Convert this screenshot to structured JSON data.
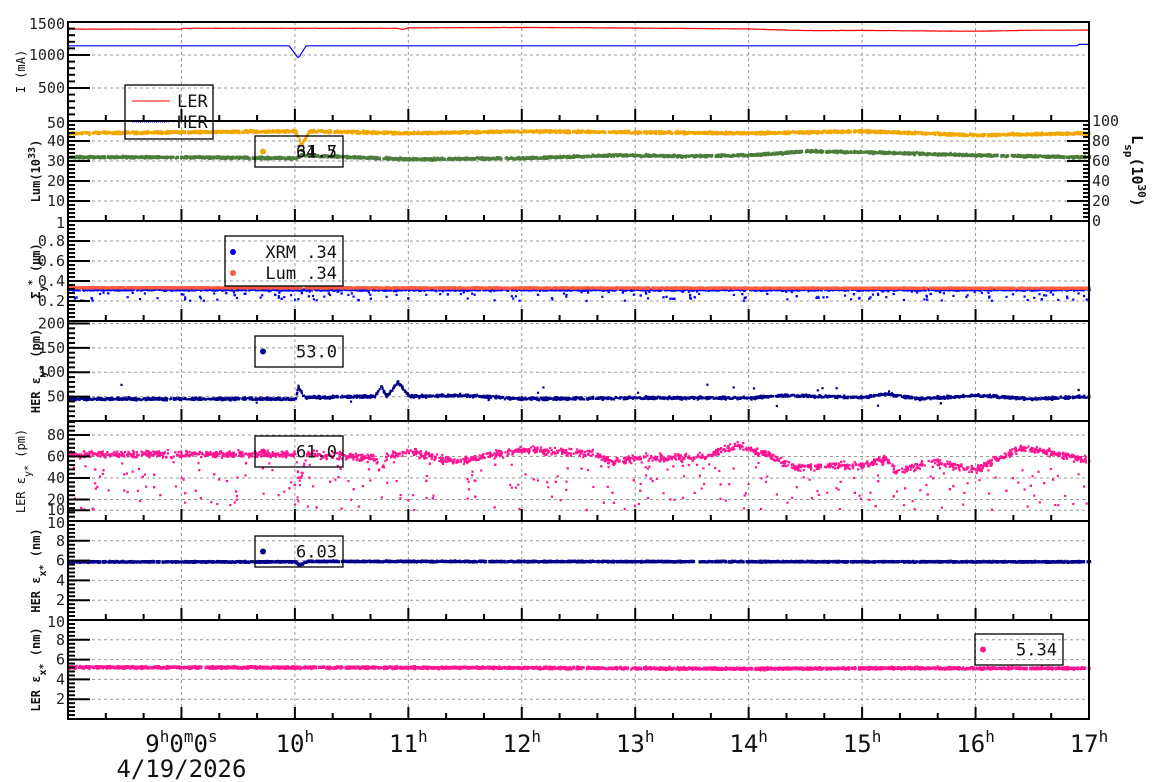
{
  "chart_data": {
    "type": "scatter",
    "title": "",
    "x_axis": {
      "unit": "hour",
      "range": [
        8,
        17
      ],
      "tick_labels": [
        {
          "h": 9,
          "main": "9",
          "sup": "h",
          "extra": "0",
          "sup2": "m",
          "extra2": "0",
          "sup3": "s"
        },
        {
          "h": 10,
          "main": "10",
          "sup": "h"
        },
        {
          "h": 11,
          "main": "11",
          "sup": "h"
        },
        {
          "h": 12,
          "main": "12",
          "sup": "h"
        },
        {
          "h": 13,
          "main": "13",
          "sup": "h"
        },
        {
          "h": 14,
          "main": "14",
          "sup": "h"
        },
        {
          "h": 15,
          "main": "15",
          "sup": "h"
        },
        {
          "h": 16,
          "main": "16",
          "sup": "h"
        },
        {
          "h": 17,
          "main": "17",
          "sup": "h"
        }
      ],
      "date_label": "4/19/2026",
      "grid": true
    },
    "panels": [
      {
        "ylabel": "I (mA)",
        "ylim": [
          0,
          1500
        ],
        "ticks": [
          500,
          1000,
          1500
        ],
        "tick_labels": [
          "500",
          "1000",
          "1500"
        ],
        "minor_step": 100,
        "series": [
          {
            "name": "LER",
            "color": "#ff0000",
            "style": "line",
            "noise": 3,
            "keys": [
              [
                8,
                1392
              ],
              [
                9,
                1392
              ],
              [
                9.01,
                1405
              ],
              [
                10.9,
                1405
              ],
              [
                10.95,
                1385
              ],
              [
                11,
                1410
              ],
              [
                12,
                1418
              ],
              [
                13,
                1408
              ],
              [
                14,
                1395
              ],
              [
                14.5,
                1370
              ],
              [
                15,
                1372
              ],
              [
                16,
                1360
              ],
              [
                16.5,
                1375
              ],
              [
                17,
                1378
              ]
            ]
          },
          {
            "name": "HER",
            "color": "#0000ff",
            "style": "line",
            "noise": 0,
            "keys": [
              [
                8,
                1140
              ],
              [
                9.95,
                1140
              ],
              [
                10.03,
                950
              ],
              [
                10.1,
                1140
              ],
              [
                16.9,
                1140
              ],
              [
                16.91,
                1160
              ],
              [
                17,
                1160
              ]
            ]
          }
        ],
        "legend": {
          "entries": [
            {
              "label": "LER",
              "color": "#ff0000",
              "marker": "line"
            },
            {
              "label": "HER",
              "color": "#0000ff",
              "marker": "dotted-line"
            }
          ]
        }
      },
      {
        "ylabel": "Lum(10",
        "ylabel_sup": "33",
        "ylabel_end": ")",
        "ylim": [
          0,
          50
        ],
        "ticks": [
          10,
          20,
          30,
          40,
          50
        ],
        "tick_labels": [
          "10",
          "20",
          "30",
          "40",
          "50"
        ],
        "minor_step": 2,
        "right_axis": {
          "label": "L",
          "label_sub": "sp",
          "label_mid": "(10",
          "label_sup": "30",
          "label_end": ")",
          "ylim": [
            0,
            100
          ],
          "ticks": [
            0,
            20,
            40,
            60,
            80,
            100
          ],
          "tick_labels": [
            "0",
            "20",
            "40",
            "60",
            "80",
            "100"
          ]
        },
        "series": [
          {
            "name": "Lsp",
            "color": "#f0a800",
            "style": "dense",
            "noise": 0.8,
            "keys": [
              [
                8,
                44
              ],
              [
                9,
                44.5
              ],
              [
                10,
                45
              ],
              [
                10.05,
                38
              ],
              [
                10.12,
                45
              ],
              [
                11,
                44
              ],
              [
                12,
                45
              ],
              [
                13,
                44.5
              ],
              [
                14,
                44
              ],
              [
                15,
                45
              ],
              [
                15.5,
                44
              ],
              [
                16,
                43
              ],
              [
                17,
                44
              ]
            ]
          },
          {
            "name": "Lum",
            "color": "#4a7d3a",
            "style": "dense",
            "noise": 0.7,
            "keys": [
              [
                8,
                32
              ],
              [
                9,
                32
              ],
              [
                10,
                31.5
              ],
              [
                10.05,
                33
              ],
              [
                11,
                31
              ],
              [
                12,
                31.5
              ],
              [
                12.8,
                33
              ],
              [
                13.5,
                32.5
              ],
              [
                14,
                33
              ],
              [
                14.5,
                35
              ],
              [
                15,
                34.5
              ],
              [
                16,
                33
              ],
              [
                17,
                32
              ]
            ]
          }
        ],
        "legend": {
          "entries": [
            {
              "label": "64.7",
              "color": "#f0a800",
              "marker": "dot"
            },
            {
              "label": "31.5",
              "color": "#4a7d3a",
              "marker": "none"
            }
          ]
        }
      },
      {
        "ylabel": "Σ",
        "ylabel_sub": "y",
        "ylabel_sup": "*",
        "ylabel_end": " (µm)",
        "ylim": [
          0,
          1
        ],
        "ticks": [
          0.2,
          0.4,
          0.6,
          0.8,
          1
        ],
        "tick_labels": [
          "0.2",
          "0.4",
          "0.6",
          "0.8",
          "1"
        ],
        "minor_step": 0.04,
        "series": [
          {
            "name": "XRM",
            "color": "#0000ff",
            "style": "scatter",
            "noise": 0.012,
            "outliers": 0.08,
            "out_range": [
              0.2,
              0.3
            ],
            "keys": [
              [
                8,
                0.31
              ],
              [
                17,
                0.31
              ]
            ]
          },
          {
            "name": "Lum",
            "color": "#ff5a3c",
            "style": "dense",
            "noise": 0.006,
            "keys": [
              [
                8,
                0.335
              ],
              [
                17,
                0.33
              ]
            ]
          }
        ],
        "legend": {
          "entries": [
            {
              "label": "XRM  .34",
              "color": "#0000ff",
              "marker": "dot"
            },
            {
              "label": "Lum  .34",
              "color": "#ff5a3c",
              "marker": "dot"
            }
          ]
        }
      },
      {
        "ylabel": "HER ε",
        "ylabel_sub": "y*",
        "ylabel_end": " (pm)",
        "ylim": [
          0,
          205
        ],
        "ticks": [
          50,
          100,
          150,
          200
        ],
        "tick_labels": [
          "50",
          "100",
          "150",
          "200"
        ],
        "minor_step": 10,
        "series": [
          {
            "name": "HER εy*",
            "color": "#00008b",
            "style": "scatter",
            "noise": 4,
            "outliers": 0.01,
            "out_range": [
              30,
              75
            ],
            "keys": [
              [
                8,
                45
              ],
              [
                10,
                45
              ],
              [
                10.02,
                70
              ],
              [
                10.08,
                48
              ],
              [
                10.7,
                50
              ],
              [
                10.75,
                72
              ],
              [
                10.8,
                50
              ],
              [
                10.9,
                80
              ],
              [
                11,
                50
              ],
              [
                11.5,
                52
              ],
              [
                12,
                45
              ],
              [
                13,
                47
              ],
              [
                14,
                47
              ],
              [
                14.3,
                52
              ],
              [
                15,
                48
              ],
              [
                15.2,
                55
              ],
              [
                15.5,
                45
              ],
              [
                16,
                52
              ],
              [
                16.5,
                45
              ],
              [
                17,
                50
              ]
            ]
          }
        ],
        "legend": {
          "entries": [
            {
              "label": "53.0",
              "color": "#00008b",
              "marker": "dot"
            }
          ]
        }
      },
      {
        "ylabel": "LER ε",
        "ylabel_sub": "y*",
        "ylabel_end": " (pm)",
        "ylim": [
          0,
          93
        ],
        "ticks": [
          10,
          20,
          40,
          60,
          80
        ],
        "tick_labels": [
          "10",
          "20",
          "40",
          "60",
          "80"
        ],
        "minor_step": 4,
        "series": [
          {
            "name": "LER εy*",
            "color": "#ff1493",
            "style": "scatter",
            "noise": 5,
            "outliers": 0.12,
            "out_range": [
              10,
              55
            ],
            "keys": [
              [
                8,
                62
              ],
              [
                9,
                62
              ],
              [
                10,
                62
              ],
              [
                10.03,
                35
              ],
              [
                10.1,
                62
              ],
              [
                10.7,
                58
              ],
              [
                10.75,
                45
              ],
              [
                10.8,
                60
              ],
              [
                11,
                65
              ],
              [
                11.4,
                55
              ],
              [
                12,
                66
              ],
              [
                12.6,
                63
              ],
              [
                12.8,
                55
              ],
              [
                13,
                58
              ],
              [
                13.6,
                60
              ],
              [
                13.9,
                70
              ],
              [
                14.2,
                60
              ],
              [
                14.4,
                50
              ],
              [
                15,
                52
              ],
              [
                15.2,
                58
              ],
              [
                15.3,
                45
              ],
              [
                15.6,
                55
              ],
              [
                16,
                48
              ],
              [
                16.4,
                68
              ],
              [
                17,
                56
              ]
            ]
          }
        ],
        "legend": {
          "entries": [
            {
              "label": "61.0",
              "color": "#ff1493",
              "marker": "dot"
            }
          ]
        }
      },
      {
        "ylabel": "HER ε",
        "ylabel_sub": "x*",
        "ylabel_end": " (nm)",
        "ylim": [
          0,
          10
        ],
        "ticks": [
          2,
          4,
          6,
          8,
          10
        ],
        "tick_labels": [
          "2",
          "4",
          "6",
          "8",
          "10"
        ],
        "minor_step": 0.4,
        "series": [
          {
            "name": "HER εx*",
            "color": "#00008b",
            "style": "dense",
            "noise": 0.08,
            "keys": [
              [
                8,
                5.9
              ],
              [
                10,
                5.9
              ],
              [
                10.03,
                5.55
              ],
              [
                10.1,
                5.95
              ],
              [
                17,
                5.9
              ]
            ]
          }
        ],
        "legend": {
          "entries": [
            {
              "label": "6.03",
              "color": "#00008b",
              "marker": "dot"
            }
          ]
        }
      },
      {
        "ylabel": "LER ε",
        "ylabel_sub": "x*",
        "ylabel_end": " (nm)",
        "ylim": [
          0,
          10
        ],
        "ticks": [
          2,
          4,
          6,
          8,
          10
        ],
        "tick_labels": [
          "2",
          "4",
          "6",
          "8",
          "10"
        ],
        "minor_step": 0.4,
        "series": [
          {
            "name": "LER εx*",
            "color": "#ff1493",
            "style": "dense",
            "noise": 0.15,
            "keys": [
              [
                8,
                5.25
              ],
              [
                12,
                5.2
              ],
              [
                14,
                5.1
              ],
              [
                15,
                5.15
              ],
              [
                17,
                5.15
              ]
            ]
          }
        ],
        "legend": {
          "entries": [
            {
              "label": "5.34",
              "color": "#ff1493",
              "marker": "dot"
            }
          ]
        }
      }
    ]
  }
}
